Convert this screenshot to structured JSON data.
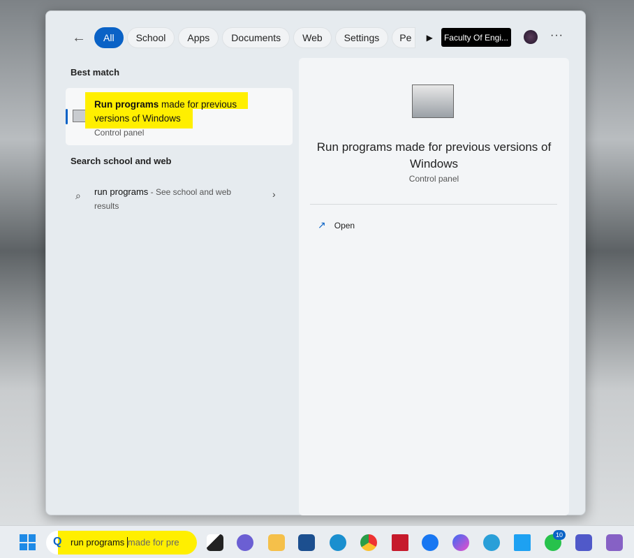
{
  "filters": {
    "back": "←",
    "chips": [
      "All",
      "School",
      "Apps",
      "Documents",
      "Web",
      "Settings",
      "Pe"
    ],
    "more_arrow": "▶"
  },
  "account": {
    "org": "Faculty Of Engi...",
    "more": "···"
  },
  "best_match": {
    "heading": "Best match",
    "title_bold": "Run programs",
    "title_rest": " made for previous versions of Windows",
    "subtitle": "Control panel"
  },
  "web": {
    "heading": "Search school and web",
    "query": "run programs",
    "suffix": " - See school and web results"
  },
  "preview": {
    "title": "Run programs made for previous versions of Windows",
    "subtitle": "Control panel",
    "actions": [
      {
        "label": "Open",
        "icon": "open-external-icon"
      }
    ]
  },
  "taskbar": {
    "search_text": "run programs ",
    "search_suggestion": "made for pre",
    "whatsapp_badge": "10",
    "icons": [
      "task-view",
      "meet",
      "file-explorer",
      "store",
      "edge",
      "chrome",
      "autocad",
      "facebook",
      "messenger",
      "telegram",
      "twitter",
      "whatsapp",
      "teams",
      "visual-studio"
    ]
  },
  "colors": {
    "accent": "#0a62c6",
    "highlight": "#ffef00"
  }
}
